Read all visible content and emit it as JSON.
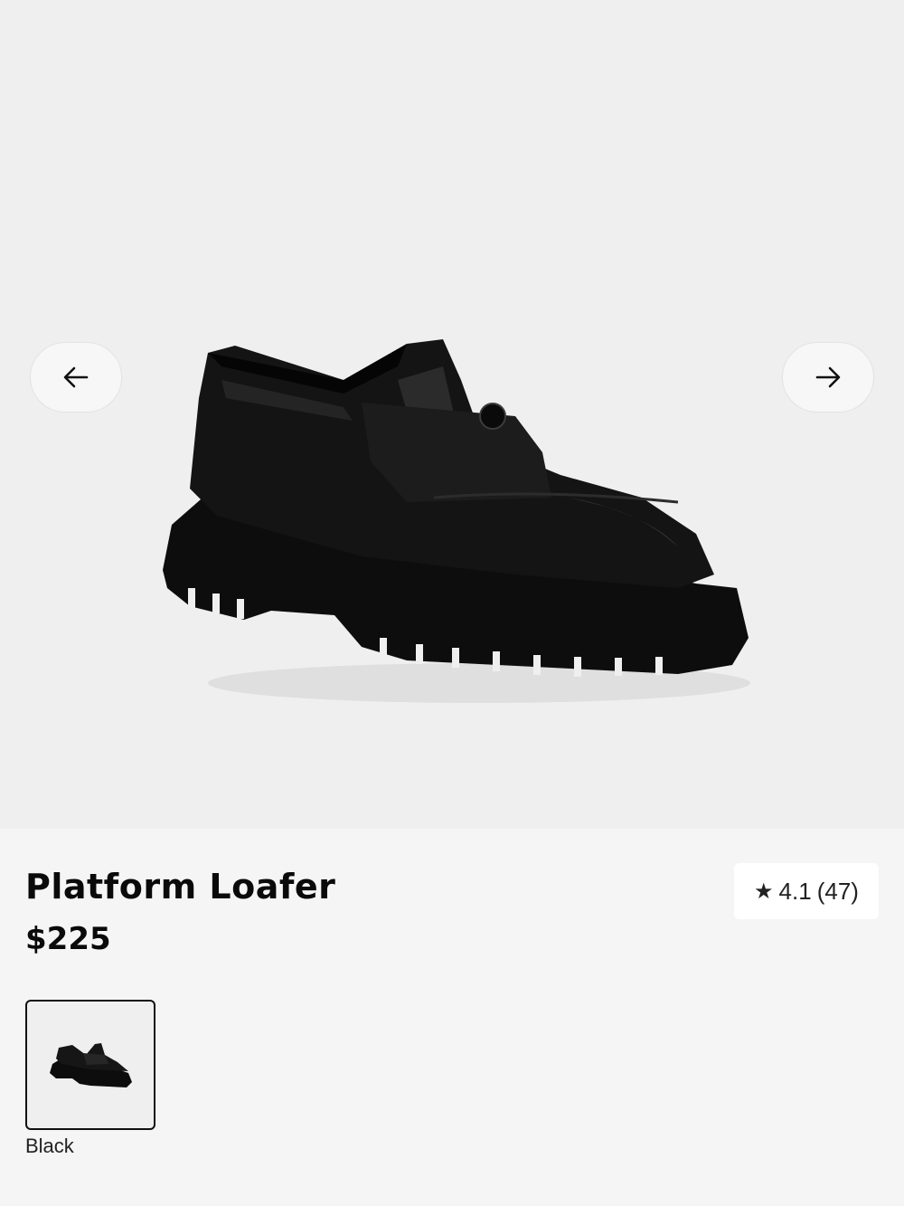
{
  "product": {
    "name": "Platform Loafer",
    "price": "$225",
    "rating": {
      "star_icon": "star-icon",
      "score": "4.1",
      "count": "(47)"
    },
    "image_alt": "Black patent platform loafer"
  },
  "gallery": {
    "prev_icon": "arrow-left-icon",
    "next_icon": "arrow-right-icon"
  },
  "colors": {
    "selected": "Black",
    "swatches": [
      {
        "label": "Black"
      }
    ]
  },
  "theme": {
    "gallery_bg": "#efefef",
    "page_bg": "#f5f5f5",
    "text": "#0a0a0a"
  }
}
